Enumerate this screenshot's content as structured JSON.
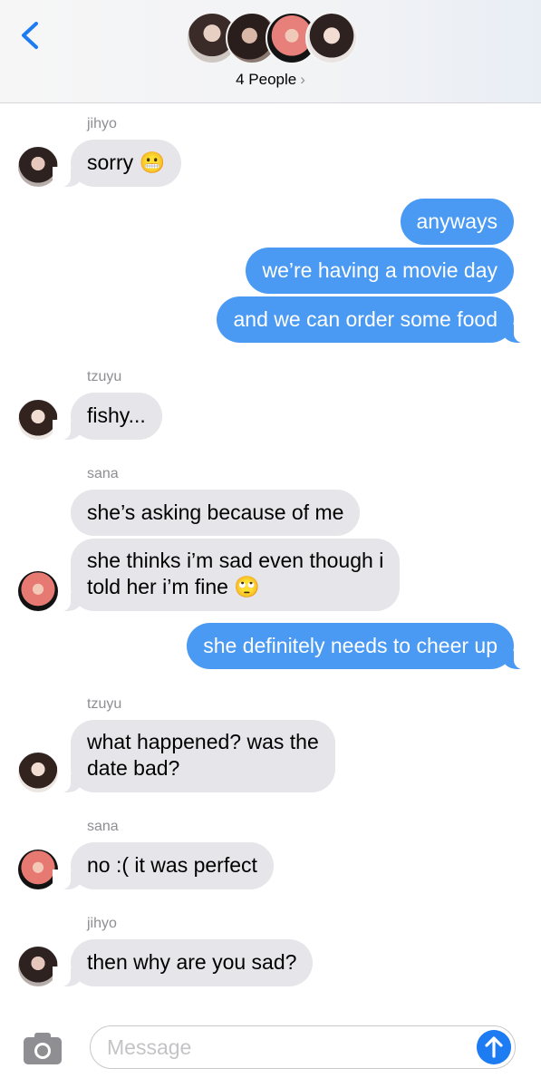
{
  "header": {
    "people_label": "4 People",
    "people_chevron": "›"
  },
  "messages": [
    {
      "sender": "jihyo",
      "text": "sorry 😬"
    },
    {
      "text": "anyways"
    },
    {
      "text": "we’re having a movie day"
    },
    {
      "text": "and we can order some food"
    },
    {
      "sender": "tzuyu",
      "text": "fishy..."
    },
    {
      "sender": "sana",
      "text": "she’s asking because of me"
    },
    {
      "line1": "she thinks i’m sad even though i",
      "line2": "told her i’m fine 🙄"
    },
    {
      "text": "she definitely needs to cheer up"
    },
    {
      "sender": "tzuyu",
      "line1": "what happened? was the",
      "line2": "date bad?"
    },
    {
      "sender": "sana",
      "text": "no :( it was perfect"
    },
    {
      "sender": "jihyo",
      "text": "then why are you sad?"
    }
  ],
  "composer": {
    "placeholder": "Message"
  },
  "colors": {
    "outgoing_bubble": "#4a9af3",
    "incoming_bubble": "#e5e5ea",
    "accent": "#1e7cf2"
  },
  "icons": [
    "back-chevron-icon",
    "camera-icon",
    "send-arrow-icon"
  ]
}
